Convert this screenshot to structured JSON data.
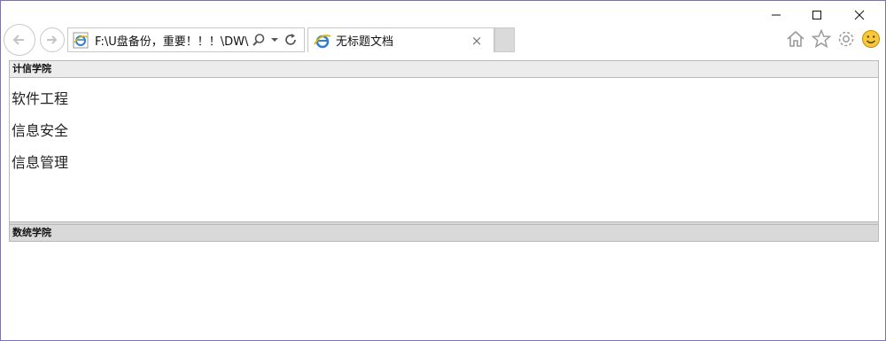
{
  "window": {
    "buttons": {
      "minimize": "minimize",
      "maximize": "maximize",
      "close": "close"
    }
  },
  "toolbar": {
    "address": "F:\\U盘备份，重要！！！\\DW\\",
    "tab_title": "无标题文档",
    "tab_close": "×",
    "icons": [
      "back-icon",
      "forward-icon",
      "search-icon",
      "dropdown-icon",
      "refresh-icon",
      "home-icon",
      "star-icon",
      "gear-icon",
      "smile-icon"
    ]
  },
  "page": {
    "frame1": {
      "header": "计信学院",
      "items": [
        "软件工程",
        "信息安全",
        "信息管理"
      ]
    },
    "frame2": {
      "header": "数统学院"
    }
  }
}
